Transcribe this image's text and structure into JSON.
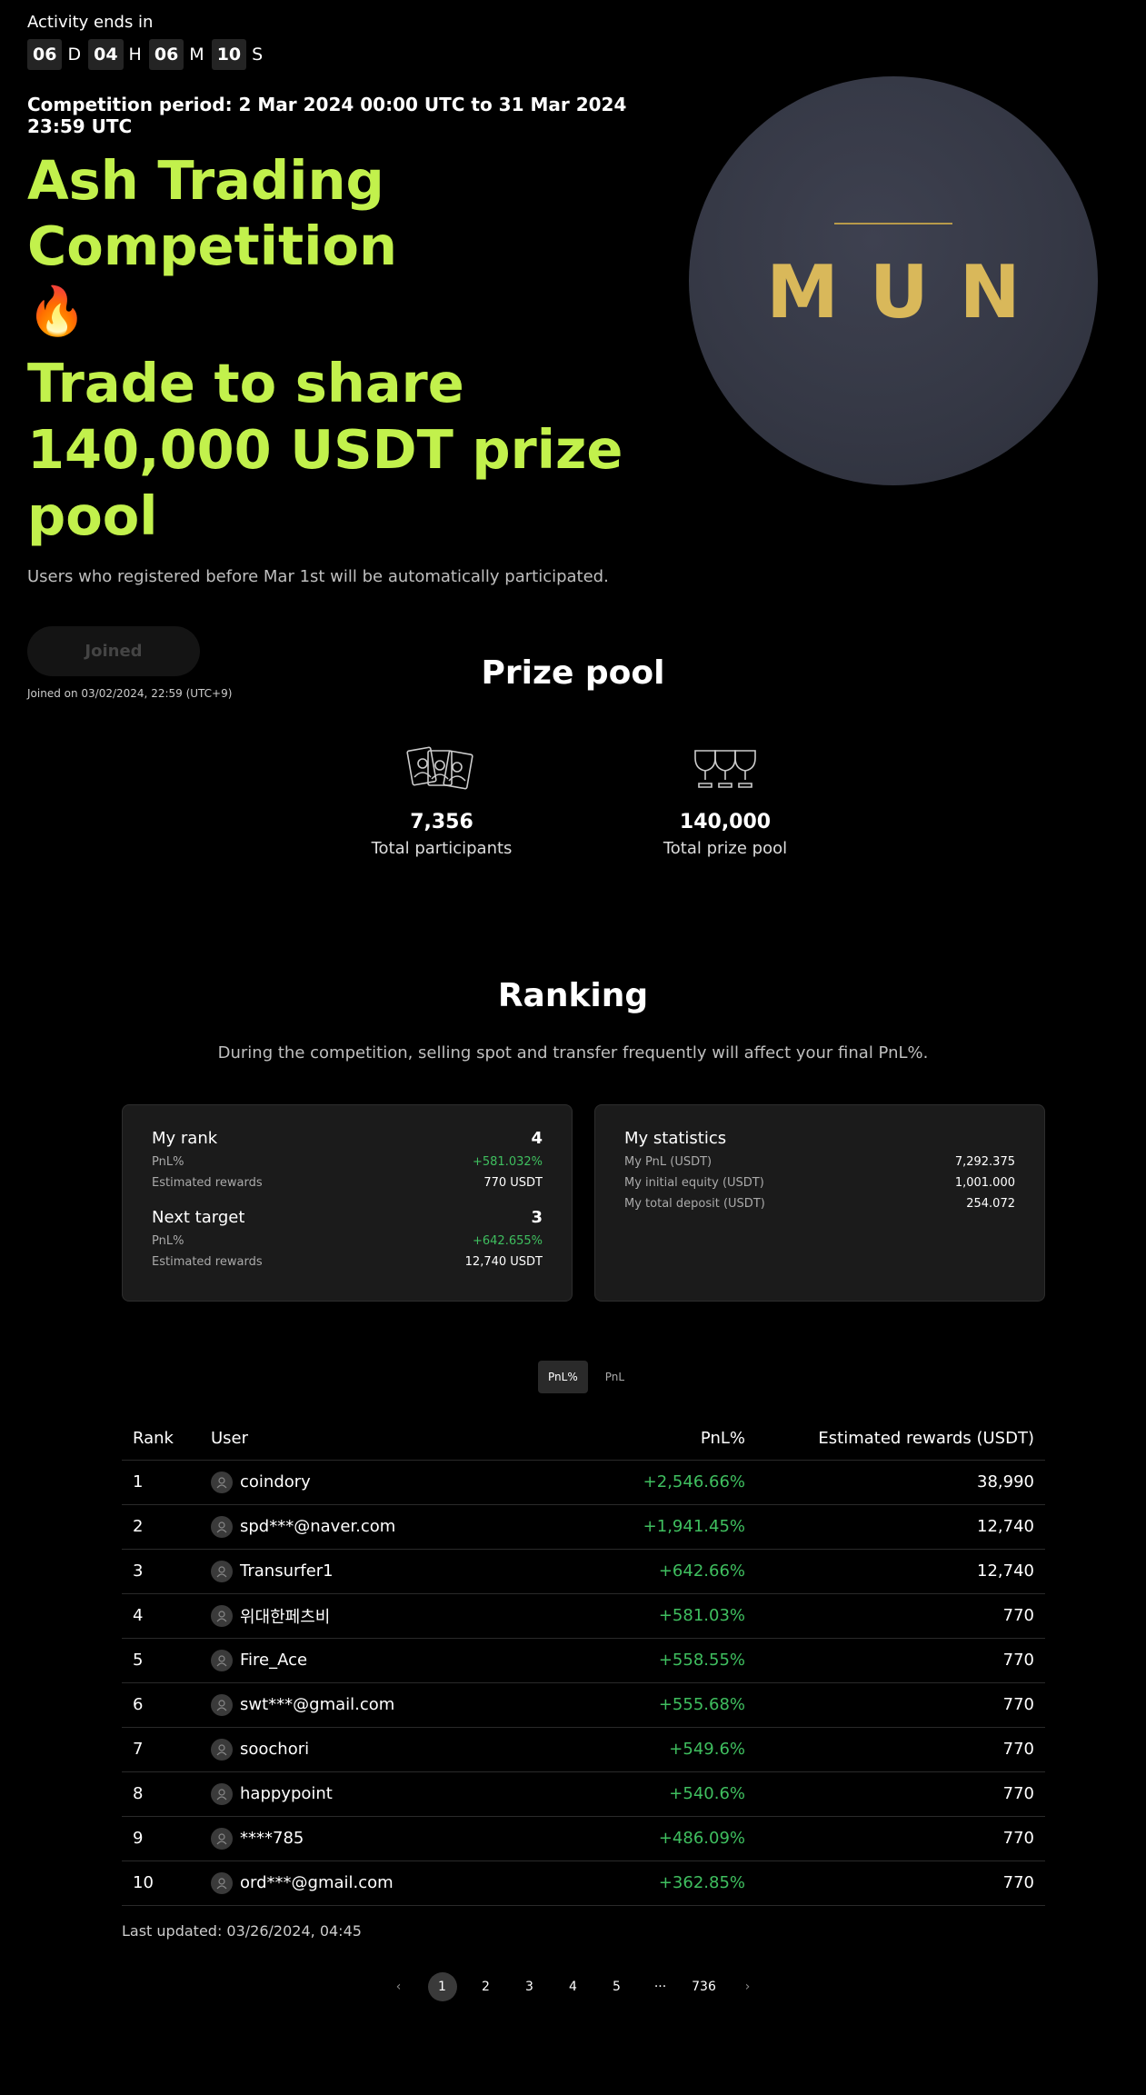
{
  "hero": {
    "ends_label": "Activity ends in",
    "countdown": {
      "days": "06",
      "d": "D",
      "hours": "04",
      "h": "H",
      "minutes": "06",
      "m": "M",
      "seconds": "10",
      "s": "S"
    },
    "period": "Competition period: 2 Mar 2024 00:00 UTC to 31 Mar 2024 23:59 UTC",
    "title_line1": "Ash Trading Competition",
    "flame": "🔥",
    "title_line2": "Trade to share 140,000 USDT prize pool",
    "subtitle": "Users who registered before Mar 1st will be automatically participated.",
    "joined_button": "Joined",
    "joined_on": "Joined on 03/02/2024, 22:59 (UTC+9)",
    "coin_text": "MUN",
    "accent_color": "#c2f14c"
  },
  "prize_pool": {
    "title": "Prize pool",
    "participants_value": "7,356",
    "participants_label": "Total participants",
    "pool_value": "140,000",
    "pool_label": "Total prize pool"
  },
  "ranking": {
    "title": "Ranking",
    "description": "During the competition, selling spot and transfer frequently will affect your final PnL%.",
    "my_rank": {
      "label": "My rank",
      "value": "4",
      "pnl_label": "PnL%",
      "pnl_value": "+581.032%",
      "rewards_label": "Estimated rewards",
      "rewards_value": "770 USDT"
    },
    "next_target": {
      "label": "Next target",
      "value": "3",
      "pnl_label": "PnL%",
      "pnl_value": "+642.655%",
      "rewards_label": "Estimated rewards",
      "rewards_value": "12,740 USDT"
    },
    "my_statistics": {
      "label": "My statistics",
      "rows": [
        {
          "label": "My PnL (USDT)",
          "value": "7,292.375"
        },
        {
          "label": "My initial equity (USDT)",
          "value": "1,001.000"
        },
        {
          "label": "My total deposit (USDT)",
          "value": "254.072"
        }
      ]
    },
    "tabs": [
      {
        "label": "PnL%",
        "active": true
      },
      {
        "label": "PnL",
        "active": false
      }
    ],
    "columns": {
      "rank": "Rank",
      "user": "User",
      "pnl": "PnL%",
      "rewards": "Estimated rewards (USDT)"
    },
    "rows": [
      {
        "rank": "1",
        "user": "coindory",
        "pnl": "+2,546.66%",
        "rewards": "38,990"
      },
      {
        "rank": "2",
        "user": "spd***@naver.com",
        "pnl": "+1,941.45%",
        "rewards": "12,740"
      },
      {
        "rank": "3",
        "user": "Transurfer1",
        "pnl": "+642.66%",
        "rewards": "12,740"
      },
      {
        "rank": "4",
        "user": "위대한페츠비",
        "pnl": "+581.03%",
        "rewards": "770"
      },
      {
        "rank": "5",
        "user": "Fire_Ace",
        "pnl": "+558.55%",
        "rewards": "770"
      },
      {
        "rank": "6",
        "user": "swt***@gmail.com",
        "pnl": "+555.68%",
        "rewards": "770"
      },
      {
        "rank": "7",
        "user": "soochori",
        "pnl": "+549.6%",
        "rewards": "770"
      },
      {
        "rank": "8",
        "user": "happypoint",
        "pnl": "+540.6%",
        "rewards": "770"
      },
      {
        "rank": "9",
        "user": "****785",
        "pnl": "+486.09%",
        "rewards": "770"
      },
      {
        "rank": "10",
        "user": "ord***@gmail.com",
        "pnl": "+362.85%",
        "rewards": "770"
      }
    ],
    "last_updated": "Last updated: 03/26/2024, 04:45",
    "pagination": {
      "prev": "‹",
      "pages": [
        "1",
        "2",
        "3",
        "4",
        "5",
        "···",
        "736"
      ],
      "active": "1",
      "next": "›"
    }
  }
}
